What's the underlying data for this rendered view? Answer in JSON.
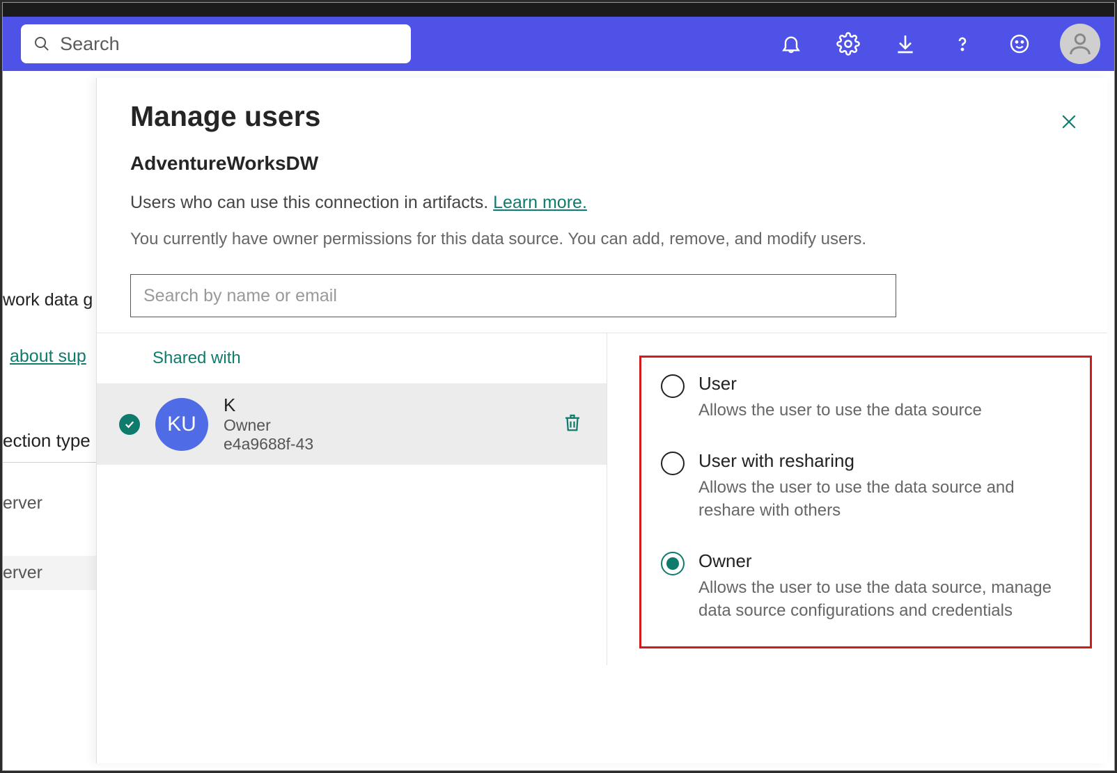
{
  "header": {
    "search_placeholder": "Search"
  },
  "background": {
    "text1": "work data g",
    "text2": "about sup",
    "text3": "ection type",
    "text4": "erver",
    "text5": "erver"
  },
  "panel": {
    "title": "Manage users",
    "subtitle": "AdventureWorksDW",
    "description_prefix": "Users who can use this connection in artifacts. ",
    "learn_more": "Learn more.",
    "permissions_note": "You currently have owner permissions for this data source. You can add, remove, and modify users.",
    "search_placeholder": "Search by name or email",
    "shared_with_label": "Shared with",
    "user": {
      "initials": "KU",
      "name": "K",
      "role": "Owner",
      "id": "e4a9688f-43"
    },
    "roles": [
      {
        "label": "User",
        "description": "Allows the user to use the data source",
        "selected": false
      },
      {
        "label": "User with resharing",
        "description": "Allows the user to use the data source and reshare with others",
        "selected": false
      },
      {
        "label": "Owner",
        "description": "Allows the user to use the data source, manage data source configurations and credentials",
        "selected": true
      }
    ]
  }
}
